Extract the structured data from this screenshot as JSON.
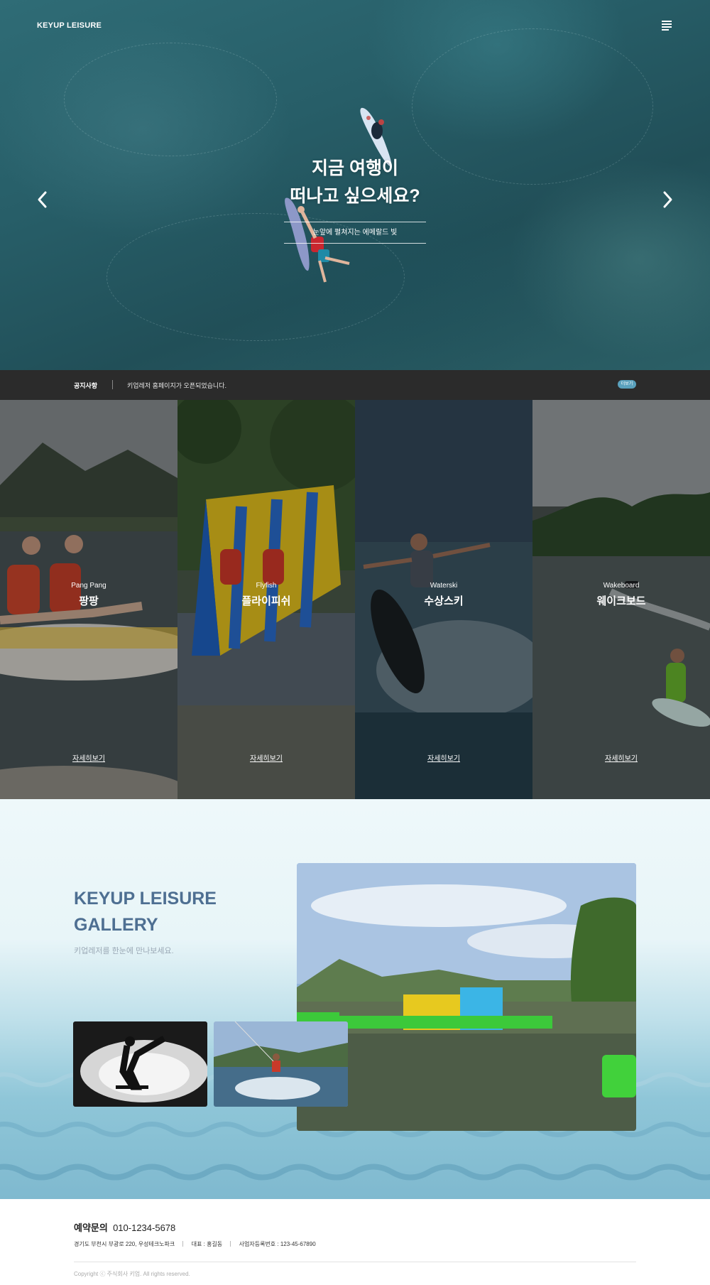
{
  "header": {
    "logo": "KEYUP LEISURE",
    "menu_icon": "menu-icon"
  },
  "hero": {
    "title_line1": "지금 여행이",
    "title_line2": "떠나고 싶으세요?",
    "subtitle": "눈앞에 펼쳐지는 에메랄드 빛",
    "prev_icon": "chevron-left-icon",
    "next_icon": "chevron-right-icon"
  },
  "notice": {
    "label": "공지사항",
    "text": "키업레저 홈페이지가 오픈되었습니다.",
    "more": "더보기"
  },
  "activities": [
    {
      "en": "Pang Pang",
      "ko": "팡팡",
      "link": "자세히보기"
    },
    {
      "en": "Flyfish",
      "ko": "플라이피쉬",
      "link": "자세히보기"
    },
    {
      "en": "Waterski",
      "ko": "수상스키",
      "link": "자세히보기"
    },
    {
      "en": "Wakeboard",
      "ko": "웨이크보드",
      "link": "자세히보기"
    }
  ],
  "gallery": {
    "title_line1": "KEYUP LEISURE",
    "title_line2": "GALLERY",
    "subtitle": "키업레저를 한눈에 만나보세요."
  },
  "footer": {
    "phone_label": "예약문의",
    "phone": "010-1234-5678",
    "address": "경기도 부천시 부광로 220, 우성테크노파크",
    "ceo": "대표 : 홍길동",
    "biz_no": "사업자등록번호 : 123-45-67890",
    "copyright": "Copyright ⓒ 주식회사 키업. All rights reserved."
  },
  "colors": {
    "notice_bg": "#2b2b2b",
    "accent": "#5aa1bd",
    "gallery_title": "#4e6f92"
  }
}
